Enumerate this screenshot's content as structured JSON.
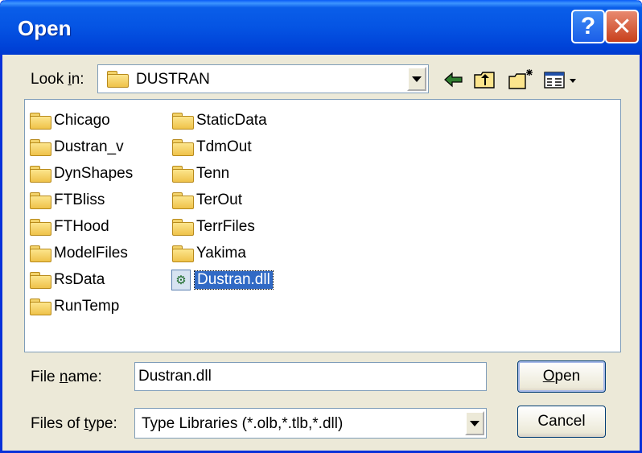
{
  "window": {
    "title": "Open",
    "help_label": "?",
    "close_label": "✕"
  },
  "lookin": {
    "label_pre": "Look ",
    "label_u": "i",
    "label_post": "n:",
    "value": "DUSTRAN"
  },
  "toolbar": {
    "icons": [
      "back-arrow-icon",
      "up-folder-icon",
      "new-folder-icon",
      "view-menu-icon"
    ]
  },
  "files": {
    "column1": [
      "Chicago",
      "Dustran_v",
      "DynShapes",
      "FTBliss",
      "FTHood",
      "ModelFiles",
      "RsData",
      "RunTemp"
    ],
    "column2": [
      "StaticData",
      "TdmOut",
      "Tenn",
      "TerOut",
      "TerrFiles",
      "Yakima"
    ],
    "selected_file": "Dustran.dll"
  },
  "filename": {
    "label_pre": "File ",
    "label_u": "n",
    "label_post": "ame:",
    "value": "Dustran.dll"
  },
  "filetype": {
    "label_pre": "Files of ",
    "label_u": "t",
    "label_post": "ype:",
    "value": "Type Libraries (*.olb,*.tlb,*.dll)"
  },
  "buttons": {
    "open_u": "O",
    "open_rest": "pen",
    "cancel": "Cancel"
  }
}
